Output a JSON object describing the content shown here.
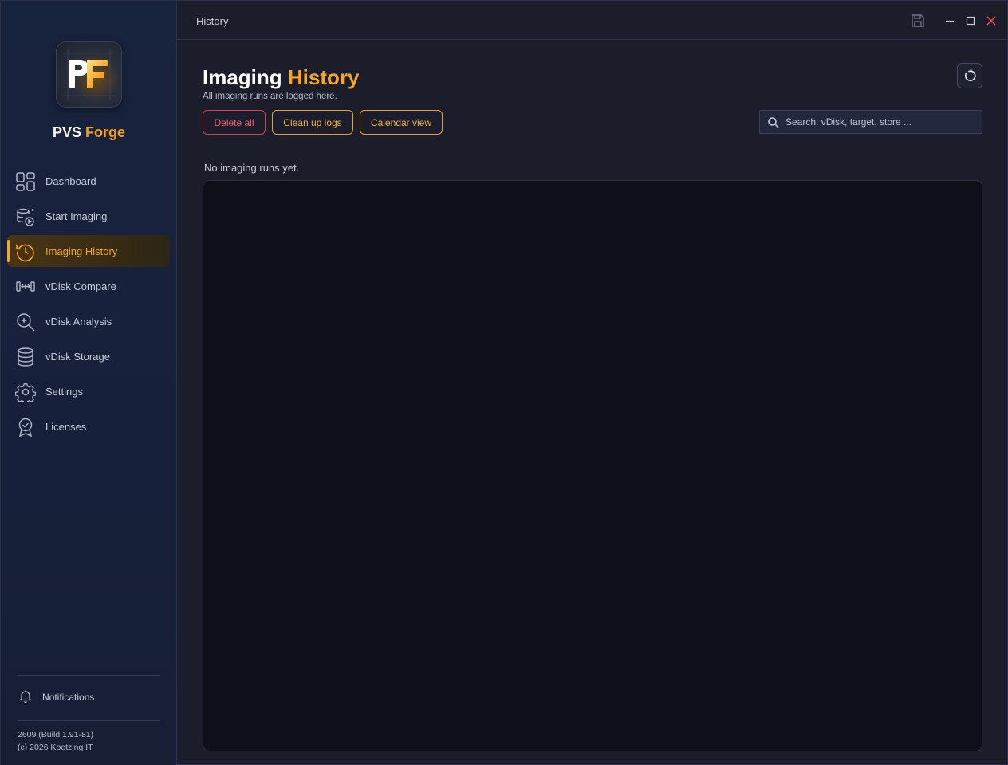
{
  "window": {
    "title": "History",
    "buttons": [
      "save-icon",
      "minimize-icon",
      "maximize-icon",
      "close-icon"
    ]
  },
  "app": {
    "logo_text": "PF",
    "name_part1": "PVS",
    "name_part2": "Forge"
  },
  "sidebar": {
    "items": [
      {
        "label": "Dashboard",
        "icon": "dashboard-icon",
        "active": false
      },
      {
        "label": "Start Imaging",
        "icon": "start-imaging-icon",
        "active": false
      },
      {
        "label": "Imaging History",
        "icon": "history-icon",
        "active": true
      },
      {
        "label": "vDisk Compare",
        "icon": "compare-icon",
        "active": false
      },
      {
        "label": "vDisk Analysis",
        "icon": "analysis-icon",
        "active": false
      },
      {
        "label": "vDisk Storage",
        "icon": "storage-icon",
        "active": false
      },
      {
        "label": "Settings",
        "icon": "gear-icon",
        "active": false
      },
      {
        "label": "Licenses",
        "icon": "license-icon",
        "active": false
      }
    ],
    "notifications_label": "Notifications",
    "version_line": "2609 (Build 1.91-81)",
    "copyright_line": "(c) 2026 Koetzing IT"
  },
  "main": {
    "heading_part1": "Imaging",
    "heading_part2": "History",
    "subtitle": "All imaging runs are logged here.",
    "buttons": {
      "delete_all": "Delete all",
      "clean_up_logs": "Clean up logs",
      "calendar_view": "Calendar view"
    },
    "search": {
      "placeholder": "Search: vDisk, target, store ...",
      "value": ""
    },
    "empty_message": "No imaging runs yet."
  },
  "colors": {
    "accent": "#f5a623",
    "danger": "#e2384c",
    "background": "#1b1d2b",
    "sidebar": "#17203a",
    "list_background": "#0e0f18"
  }
}
